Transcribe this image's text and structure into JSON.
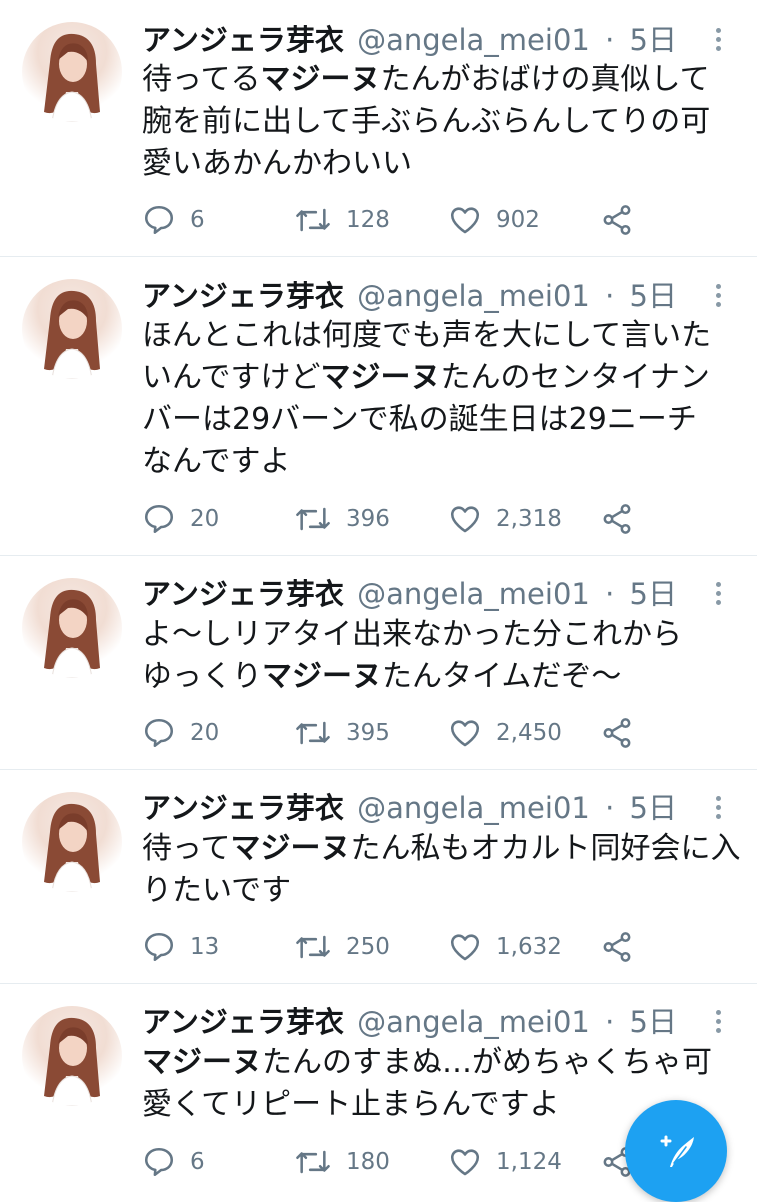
{
  "tweets": [
    {
      "name": "アンジェラ芽衣",
      "handle": "@angela_mei01",
      "sep": "·",
      "time": "5日",
      "segments": [
        {
          "t": "待ってる",
          "b": false
        },
        {
          "t": "マジーヌ",
          "b": true
        },
        {
          "t": "たんがおばけの真似して腕を前に出して手ぶらんぶらんしてりの可愛いあかんかわいい",
          "b": false
        }
      ],
      "replies": "6",
      "retweets": "128",
      "likes": "902"
    },
    {
      "name": "アンジェラ芽衣",
      "handle": "@angela_mei01",
      "sep": "·",
      "time": "5日",
      "segments": [
        {
          "t": "ほんとこれは何度でも声を大にして言いたいんですけど",
          "b": false
        },
        {
          "t": "マジーヌ",
          "b": true
        },
        {
          "t": "たんのセンタイナンバーは29バーンで私の誕生日は29ニーチなんですよ",
          "b": false
        }
      ],
      "replies": "20",
      "retweets": "396",
      "likes": "2,318"
    },
    {
      "name": "アンジェラ芽衣",
      "handle": "@angela_mei01",
      "sep": "·",
      "time": "5日",
      "segments": [
        {
          "t": "よ〜しリアタイ出来なかった分これからゆっくり",
          "b": false
        },
        {
          "t": "マジーヌ",
          "b": true
        },
        {
          "t": "たんタイムだぞ〜",
          "b": false
        }
      ],
      "replies": "20",
      "retweets": "395",
      "likes": "2,450"
    },
    {
      "name": "アンジェラ芽衣",
      "handle": "@angela_mei01",
      "sep": "·",
      "time": "5日",
      "segments": [
        {
          "t": "待って",
          "b": false
        },
        {
          "t": "マジーヌ",
          "b": true
        },
        {
          "t": "たん私もオカルト同好会に入りたいです",
          "b": false
        }
      ],
      "replies": "13",
      "retweets": "250",
      "likes": "1,632"
    },
    {
      "name": "アンジェラ芽衣",
      "handle": "@angela_mei01",
      "sep": "·",
      "time": "5日",
      "segments": [
        {
          "t": "マジーヌ",
          "b": true
        },
        {
          "t": "たんのすまぬ…がめちゃくちゃ可愛くてリピート止まらんですよ",
          "b": false
        }
      ],
      "replies": "6",
      "retweets": "180",
      "likes": "1,124"
    }
  ],
  "icons": {
    "reply": "reply-icon",
    "retweet": "retweet-icon",
    "like": "heart-icon",
    "share": "share-icon",
    "compose": "compose-tweet-icon",
    "more": "more-vertical-icon"
  },
  "colors": {
    "accent": "#1da1f2",
    "secondary_text": "#657786",
    "divider": "#e6ecf0"
  }
}
